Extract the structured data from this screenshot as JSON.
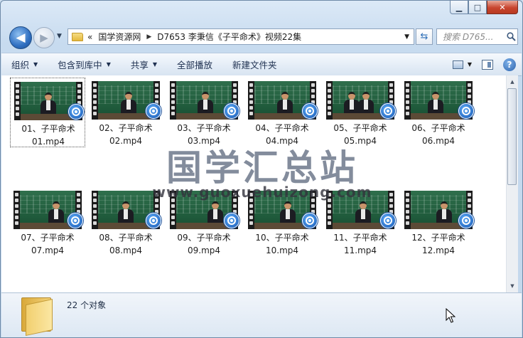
{
  "window": {
    "caption_minimize": "▁",
    "caption_maximize": "□",
    "caption_close": "✕"
  },
  "nav": {
    "back_glyph": "◀",
    "forward_glyph": "▶",
    "breadcrumb_root": "«",
    "breadcrumb": [
      "国学资源网",
      "D7653 李秉信《子平命术》视频22集"
    ],
    "search_placeholder": "搜索 D765..."
  },
  "toolbar": {
    "organize": "组织",
    "include_in_library": "包含到库中",
    "share": "共享",
    "play_all": "全部播放",
    "new_folder": "新建文件夹"
  },
  "files": [
    {
      "line1": "01、子平命术",
      "line2": "01.mp4",
      "people": [
        0.5
      ]
    },
    {
      "line1": "02、子平命术",
      "line2": "02.mp4",
      "people": [
        0.55
      ]
    },
    {
      "line1": "03、子平命术",
      "line2": "03.mp4",
      "people": [
        0.52
      ]
    },
    {
      "line1": "04、子平命术",
      "line2": "04.mp4",
      "people": [
        0.55
      ]
    },
    {
      "line1": "05、子平命术",
      "line2": "05.mp4",
      "people": [
        0.35,
        0.6
      ]
    },
    {
      "line1": "06、子平命术",
      "line2": "06.mp4",
      "people": [
        0.45
      ]
    },
    {
      "line1": "07、子平命术",
      "line2": "07.mp4",
      "people": [
        0.65
      ]
    },
    {
      "line1": "08、子平命术",
      "line2": "08.mp4",
      "people": [
        0.5
      ]
    },
    {
      "line1": "09、子平命术",
      "line2": "09.mp4",
      "people": [
        0.7
      ]
    },
    {
      "line1": "10、子平命术",
      "line2": "10.mp4",
      "people": [
        0.6
      ]
    },
    {
      "line1": "11、子平命术",
      "line2": "11.mp4",
      "people": [
        0.55
      ]
    },
    {
      "line1": "12、子平命术",
      "line2": "12.mp4",
      "people": [
        0.6
      ]
    }
  ],
  "watermark": {
    "title": "国学汇总站",
    "url": "www.guoxuehuizong.com"
  },
  "status": {
    "item_count": "22 个对象"
  },
  "colors": {
    "accent": "#2f6fc1",
    "board": "#1f5a3b",
    "close": "#c8452f"
  }
}
